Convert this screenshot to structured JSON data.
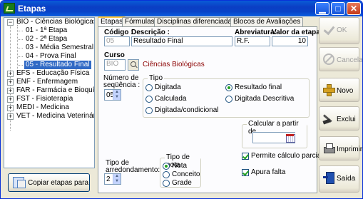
{
  "window": {
    "title": "Etapas"
  },
  "tree": {
    "nodes": [
      {
        "label": "BIO - Ciências Biológicas",
        "expander": "−",
        "level": 0
      },
      {
        "label": "01 - 1ª Etapa",
        "level": 1
      },
      {
        "label": "02 - 2ª Etapa",
        "level": 1
      },
      {
        "label": "03 - Média Semestral",
        "level": 1
      },
      {
        "label": "04 - Prova Final",
        "level": 1
      },
      {
        "label": "05 - Resultado Final",
        "level": 1,
        "selected": true
      },
      {
        "label": "EFS - Educação Física",
        "expander": "+",
        "level": 0
      },
      {
        "label": "ENF - Enfermagem",
        "expander": "+",
        "level": 0
      },
      {
        "label": "FAR - Farmácia e Bioquímica",
        "expander": "+",
        "level": 0
      },
      {
        "label": "FST - Fisioterapia",
        "expander": "+",
        "level": 0
      },
      {
        "label": "MEDI - Medicina",
        "expander": "+",
        "level": 0
      },
      {
        "label": "VET - Medicina Veterinária",
        "expander": "+",
        "level": 0
      }
    ]
  },
  "copy_button": {
    "label": "Copiar etapas para"
  },
  "tabs": [
    "Etapas",
    "Fórmulas",
    "Disciplinas diferenciadas",
    "Blocos de Avaliações"
  ],
  "form": {
    "codigo": {
      "label": "Código :",
      "value": "05"
    },
    "descricao": {
      "label": "Descrição :",
      "value": "Resultado Final"
    },
    "abreviatura": {
      "label": "Abreviatura:",
      "value": "R.F."
    },
    "valor_etapa": {
      "label": "Valor da etapa:",
      "value": "10"
    },
    "curso": {
      "label": "Curso",
      "code": "BIO",
      "name": "Ciências Biológicas"
    },
    "numero_sequencia": {
      "label_line1": "Número de",
      "label_line2": "seqüência :",
      "value": "05"
    },
    "tipo": {
      "title": "Tipo",
      "options": [
        {
          "label": "Digitada",
          "checked": false
        },
        {
          "label": "Resultado final",
          "checked": true
        },
        {
          "label": "Calculada",
          "checked": false
        },
        {
          "label": "Digitada Descritiva",
          "checked": false
        },
        {
          "label": "Digitada/condicional",
          "checked": false
        }
      ]
    },
    "calcular_a_partir": {
      "title": "Calcular a partir de",
      "value": ""
    },
    "tipo_arredondamento": {
      "label_line1": "Tipo de",
      "label_line2": "arredondamento:",
      "value": "2"
    },
    "tipo_nota": {
      "title": "Tipo de nota",
      "options": [
        {
          "label": "Nota",
          "checked": true
        },
        {
          "label": "Conceito",
          "checked": false
        },
        {
          "label": "Grade",
          "checked": false
        }
      ]
    },
    "permite_calculo_parcial": {
      "label": "Permite cálculo parcial",
      "checked": true
    },
    "apura_falta": {
      "label": "Apura falta",
      "checked": true
    }
  },
  "side_buttons": {
    "ok": {
      "label": "OK",
      "enabled": false
    },
    "cancel": {
      "label": "Cancela",
      "enabled": false
    },
    "new": {
      "label": "Novo",
      "enabled": true
    },
    "delete": {
      "label": "Exclui",
      "enabled": true
    },
    "print": {
      "label": "Imprimir",
      "enabled": true
    },
    "exit": {
      "label": "Saída",
      "enabled": true
    }
  }
}
